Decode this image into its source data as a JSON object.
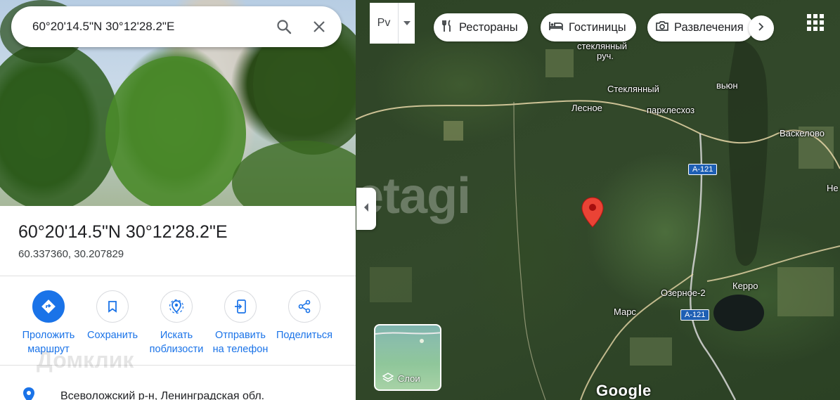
{
  "search": {
    "value": "60°20'14.5\"N 30°12'28.2\"E"
  },
  "place": {
    "title": "60°20'14.5\"N 30°12'28.2\"E",
    "decimal": "60.337360, 30.207829",
    "address": "Всеволожский р-н, Ленинградская обл."
  },
  "actions": [
    {
      "label_line1": "Проложить",
      "label_line2": "маршрут",
      "icon": "directions-icon"
    },
    {
      "label_line1": "Сохранить",
      "label_line2": "",
      "icon": "bookmark-icon"
    },
    {
      "label_line1": "Искать",
      "label_line2": "поблизости",
      "icon": "nearby-icon"
    },
    {
      "label_line1": "Отправить",
      "label_line2": "на телефон",
      "icon": "send-to-phone-icon"
    },
    {
      "label_line1": "Поделиться",
      "label_line2": "",
      "icon": "share-icon"
    }
  ],
  "map": {
    "lang_label": "Рv",
    "chips": [
      {
        "label": "Рестораны",
        "icon": "restaurant-icon"
      },
      {
        "label": "Гостиницы",
        "icon": "hotel-icon"
      },
      {
        "label": "Развлечения",
        "icon": "camera-icon"
      }
    ],
    "layers_label": "Слои",
    "google_logo": "Google",
    "places": {
      "steklyanny_ruch_1": "стеклянный",
      "steklyanny_ruch_2": "руч.",
      "steklyanny": "Стеклянный",
      "lesnoe": "Лесное",
      "parklesoz": "парклесхоз",
      "vyun": "вьюн",
      "vaskelovo": "Васкелово",
      "ne": "Не",
      "ozernoe2": "Озерное-2",
      "kerro": "Керро",
      "mars": "Марс"
    },
    "road_a121_top": "A-121",
    "road_a121_bottom": "A-121"
  },
  "watermarks": {
    "etagi": "etagi",
    "domclick": "Домклик"
  },
  "colors": {
    "accent": "#1a73e8",
    "pin": "#ea4335"
  }
}
